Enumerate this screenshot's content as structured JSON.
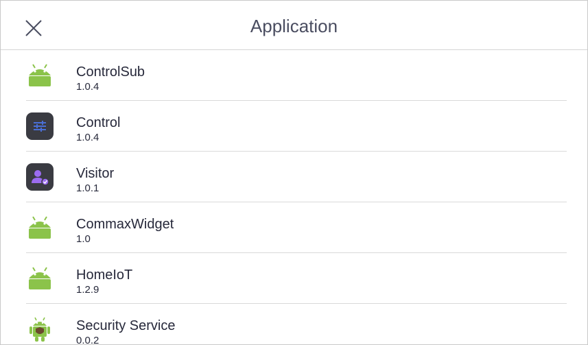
{
  "header": {
    "title": "Application",
    "close_icon": "close-icon"
  },
  "apps": [
    {
      "name": "ControlSub",
      "version": "1.0.4",
      "icon": "android-head-icon"
    },
    {
      "name": "Control",
      "version": "1.0.4",
      "icon": "sliders-icon"
    },
    {
      "name": "Visitor",
      "version": "1.0.1",
      "icon": "visitor-icon"
    },
    {
      "name": "CommaxWidget",
      "version": "1.0",
      "icon": "android-head-icon"
    },
    {
      "name": "HomeIoT",
      "version": "1.2.9",
      "icon": "android-head-icon"
    },
    {
      "name": "Security Service",
      "version": "0.0.2",
      "icon": "android-robot-icon"
    }
  ],
  "colors": {
    "android_green": "#8bc34a",
    "dark_tile": "#3a3b42",
    "accent_blue": "#4a6fd6",
    "accent_purple": "#9b6cf0",
    "title_text": "#4a4d60",
    "item_text": "#26283a"
  }
}
